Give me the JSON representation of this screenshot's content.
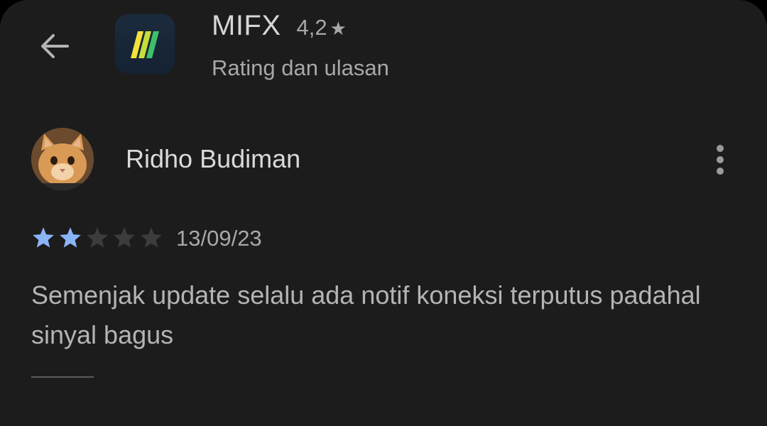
{
  "header": {
    "back_icon": "arrow-left-icon",
    "app_icon": "mifx-logo-icon",
    "app_name": "MIFX",
    "app_rating": "4,2",
    "rating_icon": "star-icon",
    "subtitle": "Rating dan ulasan"
  },
  "review": {
    "reviewer_name": "Ridho Budiman",
    "avatar_icon": "cat-avatar",
    "more_icon": "more-vertical-icon",
    "stars_filled": 2,
    "stars_total": 5,
    "date": "13/09/23",
    "text": "Semenjak update selalu ada notif koneksi terputus padahal sinyal bagus"
  },
  "colors": {
    "background": "#1c1c1c",
    "star_filled": "#8ab4f8",
    "star_empty": "#3c3c3c",
    "text_primary": "#dadada",
    "text_secondary": "#a8a8a8"
  }
}
